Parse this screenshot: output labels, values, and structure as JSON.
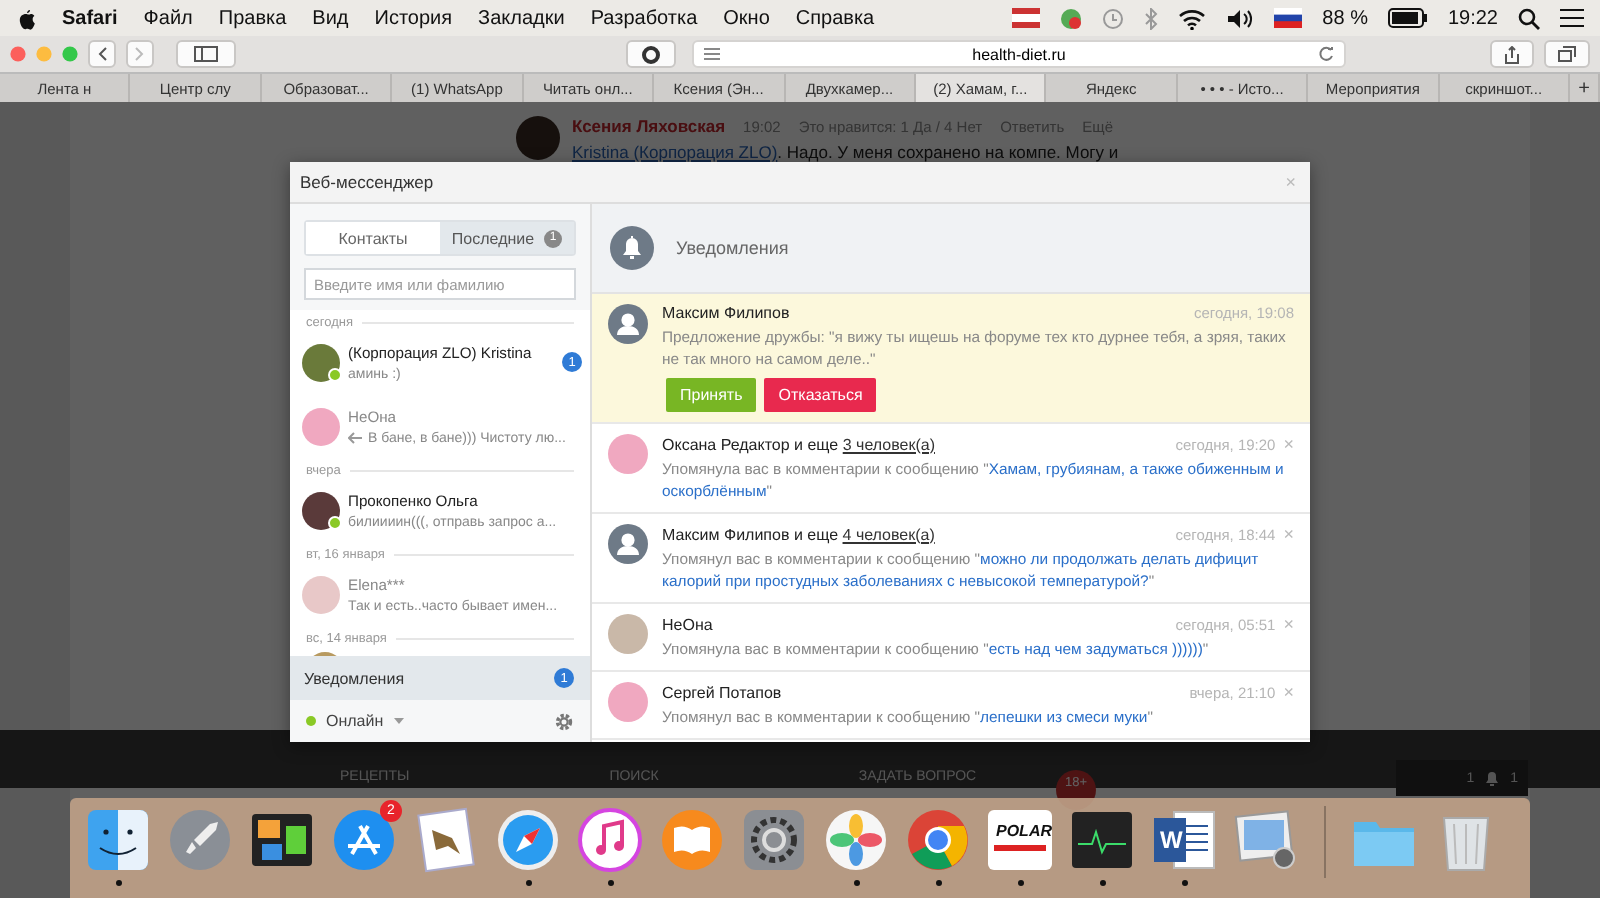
{
  "menubar": {
    "app": "Safari",
    "menus": [
      "Файл",
      "Правка",
      "Вид",
      "История",
      "Закладки",
      "Разработка",
      "Окно",
      "Справка"
    ],
    "battery": "88 %",
    "time": "19:22"
  },
  "toolbar": {
    "url": "health-diet.ru"
  },
  "tabs": [
    {
      "label": "Лента н",
      "selected": false
    },
    {
      "label": "Центр слу",
      "selected": false
    },
    {
      "label": "Образоват...",
      "selected": false
    },
    {
      "label": "(1) WhatsApp",
      "selected": false
    },
    {
      "label": "Читать онл...",
      "selected": false
    },
    {
      "label": "Ксения (Эн...",
      "selected": false
    },
    {
      "label": "Двухкамер...",
      "selected": false
    },
    {
      "label": "(2) Хамам, г...",
      "selected": true
    },
    {
      "label": "Яндекс",
      "selected": false
    },
    {
      "label": "• • • - Исто...",
      "selected": false
    },
    {
      "label": "Мероприятия",
      "selected": false
    },
    {
      "label": "скриншот...",
      "selected": false
    },
    {
      "label": "+",
      "selected": false
    }
  ],
  "page": {
    "comment": {
      "author": "Ксения Ляховская",
      "time": "19:02",
      "likes": "Это нравится: 1 Да / 4 Нет",
      "reply": "Ответить",
      "more": "Ещё",
      "mention": "Kristina (Корпорация ZLO)",
      "text": ". Надо. У меня сохранено на компе. Могу и"
    },
    "nav": [
      "РЕЦЕПТЫ",
      "ПОИСК",
      "ЗАДАТЬ ВОПРОС"
    ],
    "age_badge": "18+",
    "widget": [
      "1",
      "1"
    ]
  },
  "messenger": {
    "title": "Веб-мессенджер",
    "close": "×",
    "tabs": [
      {
        "label": "Контакты",
        "selected": true
      },
      {
        "label": "Последние",
        "badge": "1",
        "selected": false
      }
    ],
    "search": {
      "placeholder": "Введите имя или фамилию"
    },
    "groups": [
      {
        "date": "сегодня",
        "chats": [
          {
            "name": "(Корпорация ZLO) Kristina",
            "preview": "аминь :)",
            "online": true,
            "replied": false,
            "unread": "1"
          },
          {
            "name": "НеОна",
            "preview": "В бане, в бане))) Чистоту лю...",
            "online": false,
            "replied": true
          }
        ]
      },
      {
        "date": "вчера",
        "chats": [
          {
            "name": "Прокопенко Ольга",
            "preview": "билиииин(((, отправь запрос а...",
            "online": true,
            "replied": false
          }
        ]
      },
      {
        "date": "вт, 16 января",
        "chats": [
          {
            "name": "Elena***",
            "preview": "Так и есть..часто бывает имен...",
            "online": false,
            "replied": false
          }
        ]
      },
      {
        "date": "вс, 14 января"
      }
    ],
    "notifications_tab": {
      "label": "Уведомления",
      "badge": "1"
    },
    "status": {
      "label": "Онлайн",
      "online": true
    },
    "panel_title": "Уведомления",
    "notifications": [
      {
        "kind": "friend_request",
        "name": "Максим Филипов",
        "time": "сегодня, 19:08",
        "has_photo": false,
        "text": "Предложение дружбы: \"я вижу ты ищешь на форуме тех кто дурнее тебя, а зряя, таких не так много на самом деле..\"",
        "accept": "Принять",
        "decline": "Отказаться"
      },
      {
        "kind": "mention",
        "name": "Оксана Редактор",
        "others_prefix": "и еще",
        "others": "3 человек(а)",
        "time": "сегодня, 19:20",
        "has_photo": true,
        "text": "Упомянула вас в комментарии к сообщению \"",
        "link": "Хамам, грубиянам, а также обиженным и оскорблённым",
        "after": "\"",
        "close": "×"
      },
      {
        "kind": "mention",
        "name": "Максим Филипов",
        "others_prefix": "и еще",
        "others": "4 человек(а)",
        "time": "сегодня, 18:44",
        "has_photo": false,
        "text": "Упомянул вас в комментарии к сообщению \"",
        "link": "можно ли продолжать делать дифицит калорий при простудных заболеваниях с невысокой температурой?",
        "after": "\"",
        "close": "×"
      },
      {
        "kind": "mention",
        "name": "НеОна",
        "time": "сегодня, 05:51",
        "has_photo": true,
        "text": "Упомянула вас в комментарии к сообщению \"",
        "link": "есть над чем задуматься ))))))",
        "after": "\"",
        "close": "×"
      },
      {
        "kind": "mention",
        "name": "Сергей Потапов",
        "time": "вчера, 21:10",
        "has_photo": true,
        "text": "Упомянул вас в комментарии к сообщению \"",
        "link": "лепешки из смеси муки",
        "after": "\"",
        "close": "×"
      }
    ]
  },
  "dock": [
    {
      "kind": "finder",
      "running": true
    },
    {
      "kind": "launchpad",
      "running": false
    },
    {
      "kind": "mission",
      "running": false
    },
    {
      "kind": "appstore",
      "running": false,
      "badge": "2"
    },
    {
      "kind": "mail",
      "running": false
    },
    {
      "kind": "safari",
      "running": true
    },
    {
      "kind": "music",
      "running": true
    },
    {
      "kind": "books",
      "running": false
    },
    {
      "kind": "prefs",
      "running": false
    },
    {
      "kind": "photos",
      "running": true
    },
    {
      "kind": "chrome",
      "running": true
    },
    {
      "kind": "polar",
      "running": true,
      "label": "POLAR"
    },
    {
      "kind": "activity",
      "running": true
    },
    {
      "kind": "word",
      "running": true,
      "label": "W"
    },
    {
      "kind": "preview",
      "running": false
    },
    {
      "kind": "separator"
    },
    {
      "kind": "folder",
      "running": false
    },
    {
      "kind": "trash",
      "running": false
    }
  ]
}
